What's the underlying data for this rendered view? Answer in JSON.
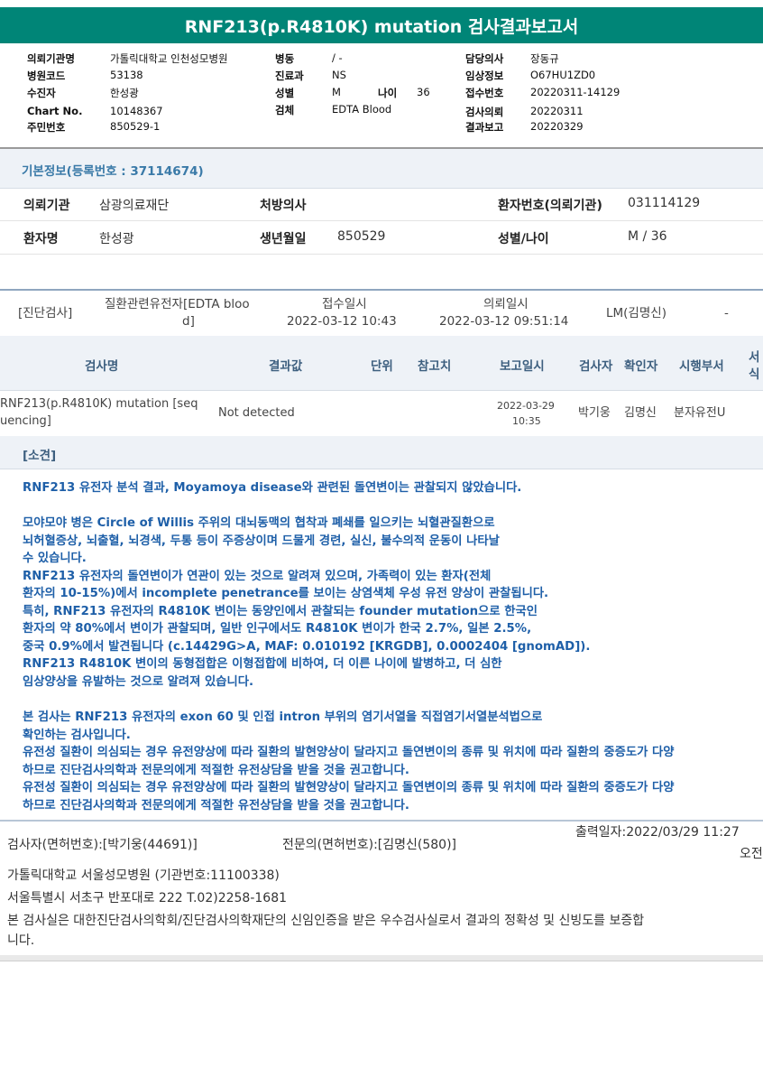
{
  "title": "RNF213(p.R4810K) mutation 검사결과보고서",
  "header": {
    "col1": [
      {
        "label": "의뢰기관명",
        "value": "가톨릭대학교 인천성모병원"
      },
      {
        "label": "병원코드",
        "value": "53138"
      },
      {
        "label": "수진자",
        "value": "한성광"
      },
      {
        "label": "Chart No.",
        "value": "10148367"
      },
      {
        "label": "주민번호",
        "value": "850529-1"
      }
    ],
    "col2": [
      {
        "label": "병동",
        "value": "/ -"
      },
      {
        "label": "진료과",
        "value": "NS"
      },
      {
        "label": "성별",
        "value": "M"
      },
      {
        "label": "검체",
        "value": "EDTA Blood"
      }
    ],
    "age_label": "나이",
    "age_value": "36",
    "col3": [
      {
        "label": "담당의사",
        "value": "장동규"
      },
      {
        "label": "임상정보",
        "value": "O67HU1ZD0"
      },
      {
        "label": "접수번호",
        "value": "20220311-14129"
      },
      {
        "label": "검사의뢰",
        "value": "20220311"
      },
      {
        "label": "결과보고",
        "value": "20220329"
      }
    ]
  },
  "basic_info": {
    "title": "기본정보(등록번호 : 37114674)",
    "row1": {
      "org_label": "의뢰기관",
      "org_value": "삼광의료재단",
      "doctor_label": "처방의사",
      "doctor_value": "",
      "patno_label": "환자번호(의뢰기관)",
      "patno_value": "031114129"
    },
    "row2": {
      "name_label": "환자명",
      "name_value": "한성광",
      "birth_label": "생년월일",
      "birth_value": "850529",
      "sexage_label": "성별/나이",
      "sexage_value": "M / 36"
    }
  },
  "diag": {
    "category": "[진단검사]",
    "specimen_line1": "질환관련유전자[EDTA bloo",
    "specimen_line2": "d]",
    "received_label": "접수일시",
    "received_value": "2022-03-12  10:43",
    "requested_label": "의뢰일시",
    "requested_value": "2022-03-12  09:51:14",
    "lm": "LM(김명신)",
    "dash": "-"
  },
  "results_table": {
    "headers": {
      "name": "검사명",
      "value": "결과값",
      "unit": "단위",
      "ref": "참고치",
      "report_date": "보고일시",
      "tester": "검사자",
      "confirmer": "확인자",
      "department": "시행부서",
      "form1": "서",
      "form2": "식"
    },
    "row": {
      "name_line1": "RNF213(p.R4810K) mutation [seq",
      "name_line2": "uencing]",
      "value": "Not detected",
      "date": "2022-03-29",
      "time": "10:35",
      "tester": "박기웅",
      "confirmer": "김명신",
      "department": "분자유전U"
    }
  },
  "findings": {
    "title": "[소견]",
    "paragraphs": [
      "RNF213 유전자 분석 결과, Moyamoya disease와 관련된 돌연변이는 관찰되지 않았습니다.",
      "",
      "모야모야 병은 Circle of Willis 주위의 대뇌동맥의 협착과 폐쇄를 일으키는 뇌혈관질환으로",
      "뇌허혈증상, 뇌출혈, 뇌경색, 두통 등이 주증상이며 드물게 경련, 실신, 불수의적 운동이 나타날",
      "수 있습니다.",
      "RNF213 유전자의 돌연변이가 연관이 있는 것으로 알려져 있으며, 가족력이 있는 환자(전체",
      "환자의 10-15%)에서 incomplete penetrance를 보이는 상염색체 우성 유전 양상이 관찰됩니다.",
      "특히, RNF213 유전자의 R4810K 변이는 동양인에서 관찰되는 founder mutation으로 한국인",
      "환자의 약 80%에서 변이가 관찰되며, 일반 인구에서도 R4810K 변이가 한국 2.7%, 일본 2.5%,",
      "중국 0.9%에서 발견됩니다 (c.14429G>A, MAF: 0.010192 [KRGDB], 0.0002404 [gnomAD]).",
      "RNF213 R4810K 변이의 동형접합은 이형접합에 비하여, 더 이른 나이에 발병하고, 더 심한",
      "임상양상을 유발하는 것으로 알려져 있습니다.",
      "",
      "본 검사는 RNF213 유전자의 exon 60 및 인접 intron 부위의 염기서열을 직접염기서열분석법으로",
      "확인하는 검사입니다.",
      "유전성 질환이 의심되는 경우 유전양상에 따라 질환의 발현양상이 달라지고 돌연변이의 종류 및 위치에 따라 질환의 중증도가 다양",
      "하므로 진단검사의학과 전문의에게 적절한 유전상담을 받을 것을 권고합니다.",
      "유전성 질환이 의심되는 경우 유전양상에 따라 질환의 발현양상이 달라지고 돌연변이의 종류 및 위치에 따라 질환의 중증도가 다양",
      "하므로 진단검사의학과 전문의에게 적절한 유전상담을 받을 것을 권고합니다."
    ]
  },
  "footer": {
    "tester": "검사자(면허번호):[박기웅(44691)]",
    "specialist": "전문의(면허번호):[김명신(580)]",
    "printed": "출력일자:2022/03/29 11:27",
    "ampm": "오전",
    "hospital": "가톨릭대학교 서울성모병원 (기관번호:11100338)",
    "address": "서울특별시 서초구 반포대로 222 T.02)2258-1681",
    "cert_line1": "본 검사실은 대한진단검사의학회/진단검사의학재단의 신임인증을 받은 우수검사실로서 결과의 정확성 및 신빙도를 보증합",
    "cert_line2": "니다."
  }
}
